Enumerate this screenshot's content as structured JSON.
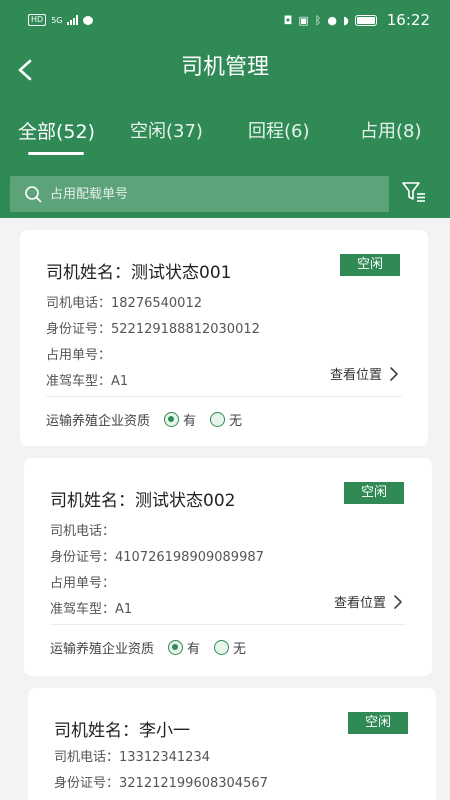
{
  "status_bar": {
    "network": "HD",
    "signal": "5G",
    "time": "16:22"
  },
  "title": "司机管理",
  "tabs": [
    {
      "label": "全部(52)"
    },
    {
      "label": "空闲(37)"
    },
    {
      "label": "回程(6)"
    },
    {
      "label": "占用(8)"
    }
  ],
  "search": {
    "placeholder": "占用配载单号"
  },
  "field_labels": {
    "name": "司机姓名：",
    "phone": "司机电话：",
    "id": "身份证号：",
    "occupied_no": "占用单号：",
    "license": "准驾车型：",
    "qualification": "运输养殖企业资质",
    "yes": "有",
    "no": "无",
    "location": "查看位置"
  },
  "drivers": [
    {
      "name": "测试状态001",
      "status": "空闲",
      "phone": "18276540012",
      "id_number": "522129188812030012",
      "occupied_no": "",
      "license": "A1",
      "qualification": "有"
    },
    {
      "name": "测试状态002",
      "status": "空闲",
      "phone": "",
      "id_number": "410726198909089987",
      "occupied_no": "",
      "license": "A1",
      "qualification": "有"
    },
    {
      "name": "李小一",
      "status": "空闲",
      "phone": "13312341234",
      "id_number": "321212199608304567"
    }
  ],
  "colors": {
    "primary": "#2f8a55",
    "background": "#f2f4f3",
    "card": "#ffffff"
  }
}
